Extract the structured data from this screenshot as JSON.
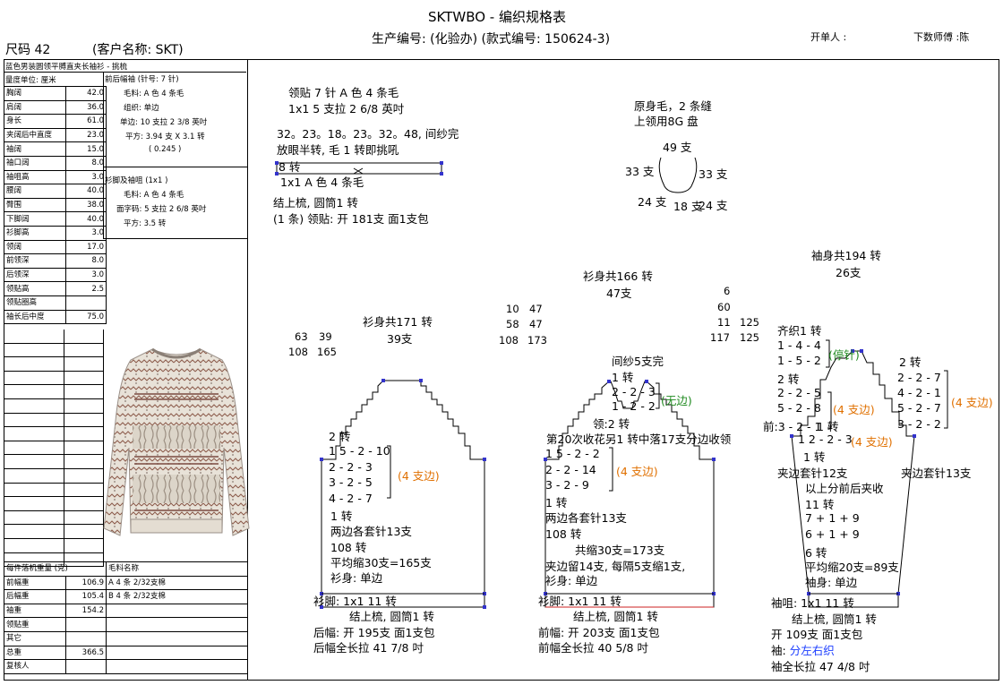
{
  "header": {
    "title": "SKTWBO - 编织规格表",
    "production": "生产编号: (化验办) (款式编号: 150624-3)",
    "size": "尺码  42",
    "customer": "(客户名称: SKT)",
    "creator": "开单人 :",
    "master": "下数师傅 :陈"
  },
  "left": {
    "garment": "蓝色男装圆领平膊直夹长袖衫 - 挑梳",
    "unit": "量度单位: 厘米",
    "rows": [
      {
        "label": "胸阔",
        "value": "42.0"
      },
      {
        "label": "肩阔",
        "value": "36.0"
      },
      {
        "label": "身长",
        "value": "61.0"
      },
      {
        "label": "夹阔后中直度",
        "value": "23.0"
      },
      {
        "label": "袖阔",
        "value": "15.0"
      },
      {
        "label": "袖口阔",
        "value": "8.0"
      },
      {
        "label": "袖咀高",
        "value": "3.0"
      },
      {
        "label": "腰阔",
        "value": "40.0"
      },
      {
        "label": "臀围",
        "value": "38.0"
      },
      {
        "label": "下脚阔",
        "value": "40.0"
      },
      {
        "label": "衫脚高",
        "value": "3.0"
      },
      {
        "label": "领阔",
        "value": "17.0"
      },
      {
        "label": "前领深",
        "value": "8.0"
      },
      {
        "label": "后领深",
        "value": "3.0"
      },
      {
        "label": "领贴高",
        "value": "2.5"
      },
      {
        "label": "领贴圈高",
        "value": ""
      },
      {
        "label": "袖长后中度",
        "value": "75.0"
      }
    ],
    "body_yarn": {
      "title": "前后幅袖 (针号: 7 针)",
      "material": "毛料: A 色 4 条毛",
      "structure": "组织: 单边",
      "gauge": "单边: 10 支拉 2 3/8 英吋",
      "square": "平方: 3.94 支 X  3.1 转",
      "ratio": "( 0.245 )"
    },
    "rib_yarn": {
      "title": "衫脚及袖咀 (1x1 )",
      "material": "毛料: A 色 4 条毛",
      "stitch": "面字码: 5 支拉 2 6/8 英吋",
      "density": "平方: 3.5 转"
    },
    "weights_title": "每件落机重量 (克)",
    "material_title": "毛料名称",
    "weights": [
      {
        "label": "前幅重",
        "value": "106.9",
        "mat": "A  4 条 2/32支棉"
      },
      {
        "label": "后幅重",
        "value": "105.4",
        "mat": "B  4 条 2/32支棉"
      },
      {
        "label": "袖重",
        "value": "154.2",
        "mat": ""
      },
      {
        "label": "领贴重",
        "value": "",
        "mat": ""
      },
      {
        "label": "其它",
        "value": "",
        "mat": ""
      },
      {
        "label": "总重",
        "value": "366.5",
        "mat": ""
      },
      {
        "label": "复核人",
        "value": "",
        "mat": ""
      }
    ]
  },
  "collar": {
    "l1": "领贴  7 针 A 色 4 条毛",
    "l2": "1x1   5 支拉 2 6/8 英吋",
    "l3": "32。23。18。23。32。48, 间纱完",
    "l4": "放眼半转, 毛 1 转即挑吼",
    "l5": "8 转",
    "l6": "1x1   A 色 4 条毛",
    "l7": "结上梳, 圆筒1 转",
    "l8": "(1 条) 领贴: 开 181支 面1支包"
  },
  "neck": {
    "t1": "原身毛，2 条缝",
    "t2": "上领用8G 盘",
    "top": "49 支",
    "left": "33 支",
    "right": "33 支",
    "bl": "24 支",
    "bm": "18 支",
    "br": "24 支"
  },
  "back": {
    "total": "衫身共171 转",
    "width": "39支",
    "n1": "63",
    "n2": "39",
    "n3": "108",
    "n4": "165",
    "s1": "2 转",
    "s2": "1  5 - 2 - 10",
    "s3": "2 - 2 - 3",
    "s4": "3 - 2 - 5",
    "s5": "4 - 2 - 7",
    "edge": "(4 支边)",
    "s6": "1 转",
    "s7": "两边各套针13支",
    "s8": "108 转",
    "s9": "平均缩30支=165支",
    "s10": "衫身: 单边",
    "rib": "衫脚:  1x1      11 转",
    "r1": "结上梳, 圆筒1 转",
    "r2": "后幅: 开 195支 面1支包",
    "r3": "后幅全长拉 41 7/8 吋"
  },
  "front": {
    "total": "衫身共166 转",
    "width": "47支",
    "n1": "10",
    "n2": "47",
    "n3": "58",
    "n4": "47",
    "n5": "108",
    "n6": "173",
    "m1": "6",
    "m2": "60",
    "m3": "11",
    "m4": "125",
    "m5": "117",
    "m6": "125",
    "a1": "间纱5支完",
    "a2": "1 转",
    "a3": "2 - 2 - 3",
    "a4": "1 - 2 - 2",
    "a5": "(无边)",
    "a6": "领:2 转",
    "a7": "第20次收花另1 转中落17支分边收领",
    "s2": "1  5 - 2 - 2",
    "s3": "2 - 2 - 14",
    "s4": "3 - 2 - 9",
    "edge": "(4 支边)",
    "s6": "1 转",
    "s7": "两边各套针13支",
    "s8": "108 转",
    "s9": "共缩30支=173支",
    "s10": "夹边留14支, 每隔5支缩1支,",
    "s11": "衫身: 单边",
    "rib": "衫脚:  1x1      11 转",
    "r1": "结上梳, 圆筒1 转",
    "r2": "前幅: 开 203支 面1支包",
    "r3": "前幅全长拉 40 5/8 吋"
  },
  "sleeve": {
    "total": "袖身共194 转",
    "width": "26支",
    "c1": "齐织1 转",
    "c2": "1 - 4 - 4",
    "c3": "1 - 5 - 2",
    "c4": "(停针)",
    "c5": "2 转",
    "c6": "2 - 2 - 5",
    "c7": "5 - 2 - 8",
    "c8": "1 转",
    "c9": "前:3 - 2 - 1",
    "edge1": "(4 支边)",
    "d1": "2 转",
    "d2": "2 - 2 - 7",
    "d3": "4 - 2 - 1",
    "d4": "5 - 2 - 7",
    "d5": "3 - 2 - 2",
    "edge2": "(4 支边)",
    "e1": "1  2 - 2 - 3",
    "edge3": "(4 支边)",
    "e2": "1 转",
    "e3": "夹边套针12支",
    "e4": "夹边套针13支",
    "e5": "以上分前后夹收",
    "e6": "11 转",
    "e7": "7 + 1 + 9",
    "e8": "6 + 1 + 9",
    "e9": "6 转",
    "e10": "平均缩20支=89支",
    "e11": "袖身: 单边",
    "rib": "袖咀:  1x1      11 转",
    "r1": "结上梳, 圆筒1 转",
    "r2": "开 109支 面1支包",
    "r3a": "袖: ",
    "r3b": "分左右织",
    "r4": "袖全长拉 47 4/8 吋"
  },
  "colors": {
    "orange": "#e07000",
    "green": "#1f8a1f",
    "blue": "#1a3cff",
    "line": "#000000",
    "mark": "#3333cc"
  }
}
